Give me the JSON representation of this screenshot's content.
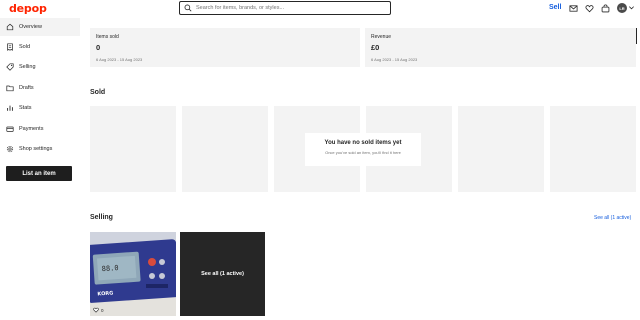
{
  "header": {
    "logo": "depop",
    "search_placeholder": "Search for items, brands, or styles...",
    "sell_label": "Sell",
    "avatar_initials": "LR",
    "icons": [
      "mail-icon",
      "heart-icon",
      "bag-icon"
    ]
  },
  "sidebar": {
    "items": [
      {
        "label": "Overview",
        "icon": "house-icon"
      },
      {
        "label": "Sold",
        "icon": "receipt-icon"
      },
      {
        "label": "Selling",
        "icon": "tag-icon"
      },
      {
        "label": "Drafts",
        "icon": "folder-icon"
      },
      {
        "label": "Stats",
        "icon": "bar-chart-icon"
      },
      {
        "label": "Payments",
        "icon": "card-icon"
      },
      {
        "label": "Shop settings",
        "icon": "gear-icon"
      }
    ],
    "active_index": 0,
    "list_button": "List an item"
  },
  "stats": {
    "items_sold": {
      "label": "Items sold",
      "value": "0",
      "dates": "6 Aug 2023 - 15 Aug 2023"
    },
    "revenue": {
      "label": "Revenue",
      "value": "£0",
      "dates": "6 Aug 2023 - 15 Aug 2023"
    }
  },
  "sold": {
    "title": "Sold",
    "empty_title": "You have no sold items yet",
    "empty_sub": "Once you've sold an item, you'll find it here"
  },
  "selling": {
    "title": "Selling",
    "see_all_link": "See all (1 active)",
    "listing_likes": "0",
    "see_all_tile": "See all (1 active)",
    "product_brand_text": "KORG"
  },
  "colors": {
    "brand": "#ff2300",
    "link": "#145ddd",
    "placeholder_bg": "#f3f3f3",
    "dark_button": "#1e1e1e"
  }
}
